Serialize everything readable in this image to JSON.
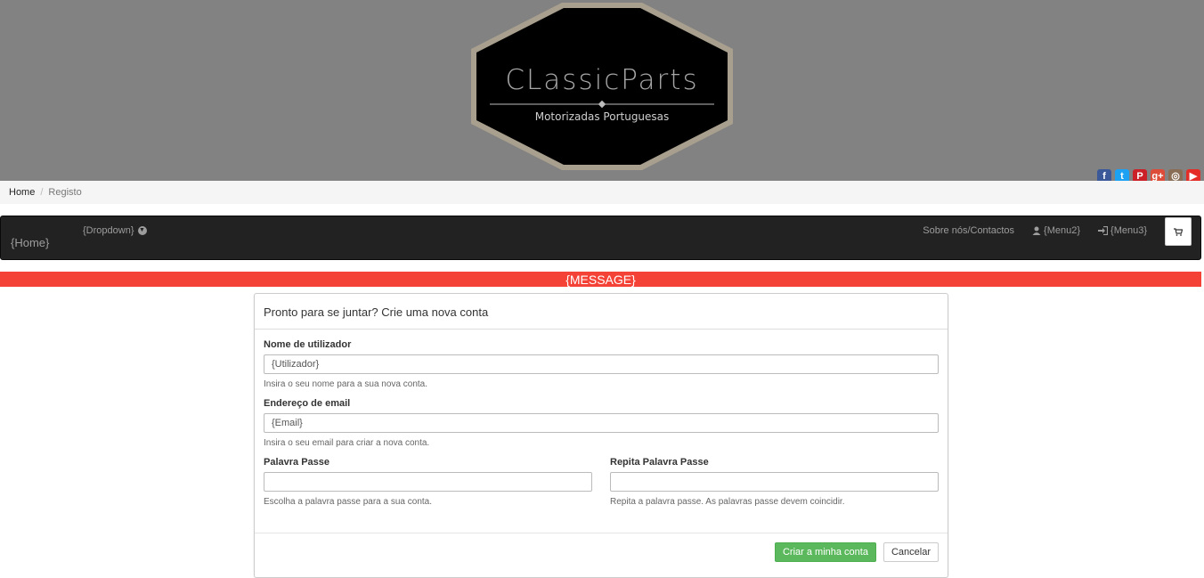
{
  "logo": {
    "title": "ClassicParts",
    "subtitle": "Motorizadas Portuguesas"
  },
  "social": [
    {
      "icon": "facebook-icon",
      "glyph": "f",
      "color": "#3b5998"
    },
    {
      "icon": "twitter-icon",
      "glyph": "t",
      "color": "#1da1f2"
    },
    {
      "icon": "pinterest-icon",
      "glyph": "P",
      "color": "#cb2027"
    },
    {
      "icon": "google-plus-icon",
      "glyph": "g+",
      "color": "#dd4b39"
    },
    {
      "icon": "instagram-icon",
      "glyph": "◎",
      "color": "#8a6d55"
    },
    {
      "icon": "youtube-icon",
      "glyph": "▶",
      "color": "#e52d27"
    }
  ],
  "breadcrumb": {
    "home": "Home",
    "current": "Registo"
  },
  "navbar": {
    "brand": "{Home}",
    "dropdown": "{Dropdown}",
    "about": "Sobre nós/Contactos",
    "menu2": "{Menu2}",
    "menu3": "{Menu3}"
  },
  "message": "{MESSAGE}",
  "form": {
    "heading": "Pronto para se juntar? Crie uma nova conta",
    "username": {
      "label": "Nome de utilizador",
      "value": "{Utilizador}",
      "help": "Insira o seu nome para a sua nova conta."
    },
    "email": {
      "label": "Endereço de email",
      "value": "{Email}",
      "help": "Insira o seu email para criar a nova conta."
    },
    "password": {
      "label": "Palavra Passe",
      "value": "",
      "help": "Escolha a palavra passe para a sua conta."
    },
    "password_repeat": {
      "label": "Repita Palavra Passe",
      "value": "",
      "help": "Repita a palavra passe. As palavras passe devem coincidir."
    },
    "submit_label": "Criar a minha conta",
    "cancel_label": "Cancelar"
  },
  "colors": {
    "banner": "#828282",
    "navbar": "#222222",
    "message": "#f44336",
    "success": "#5cb85c"
  }
}
